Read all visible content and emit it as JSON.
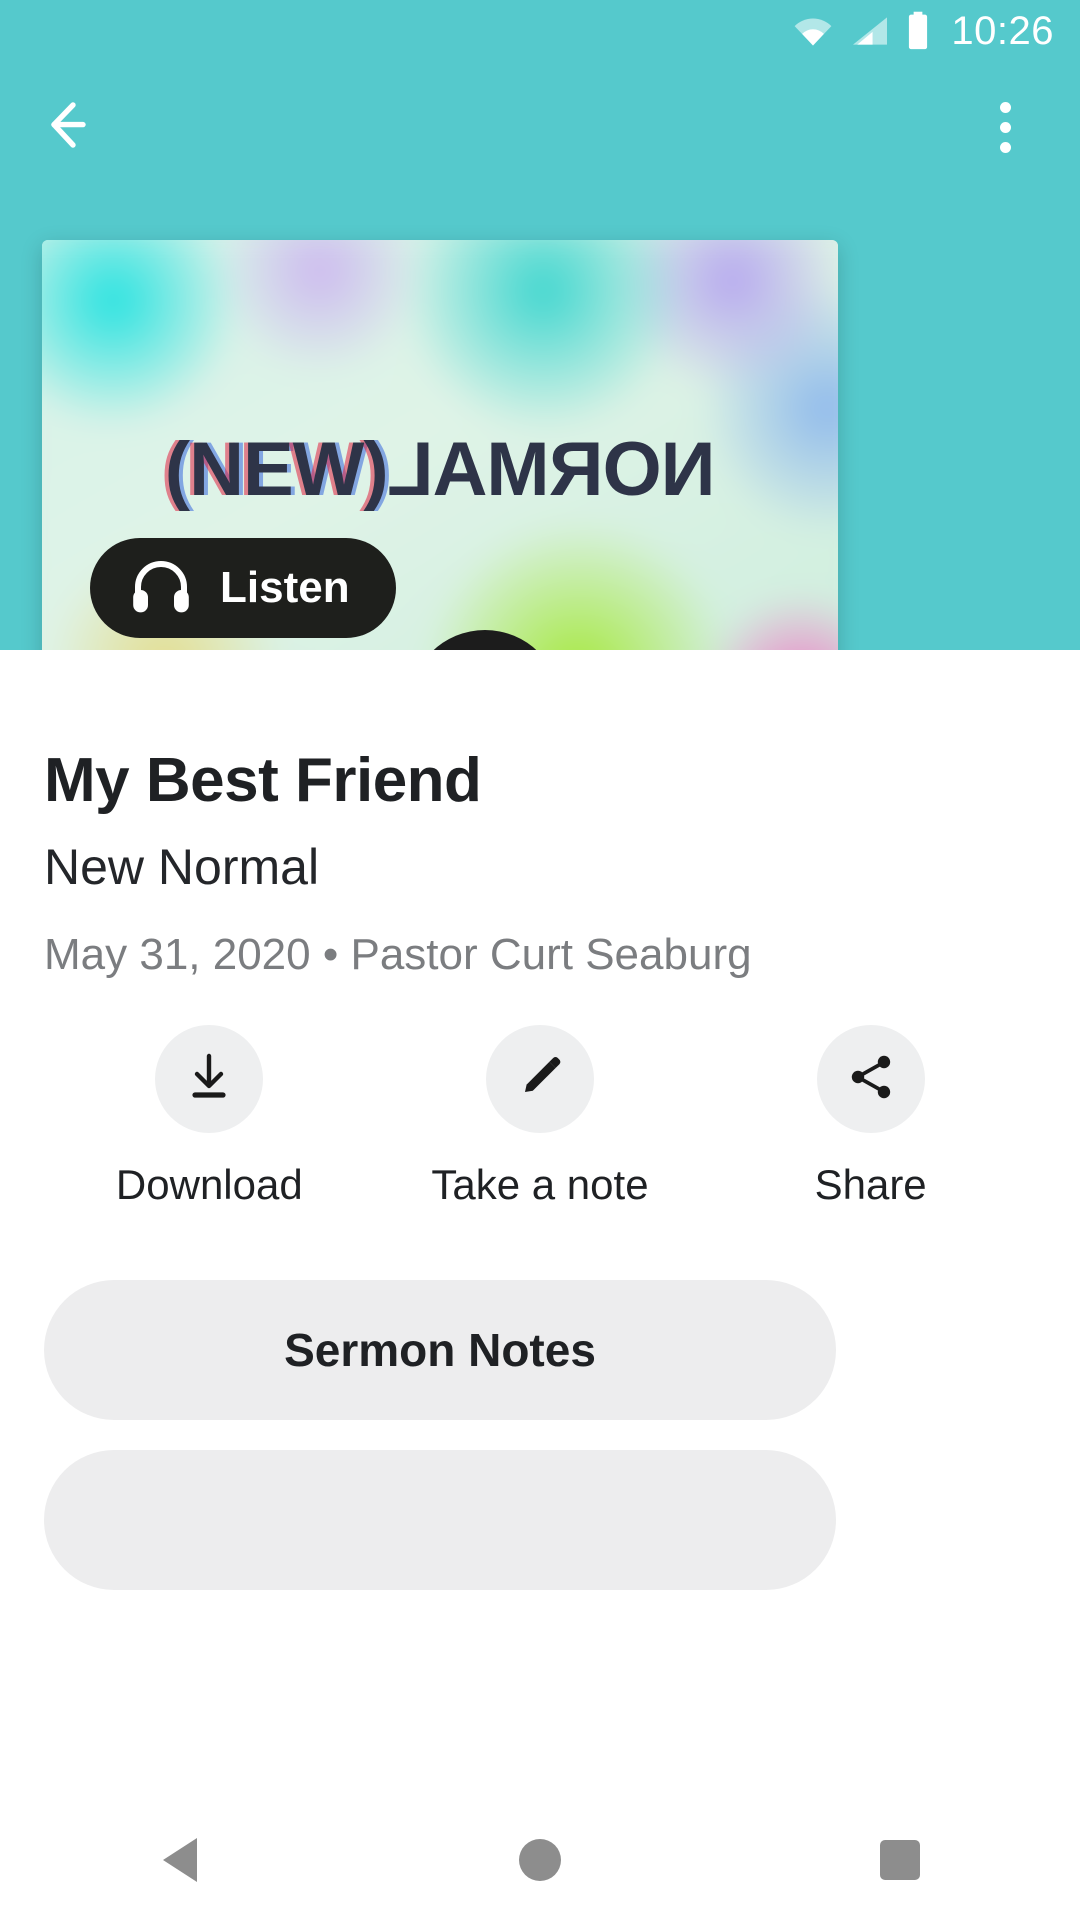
{
  "status_bar": {
    "time": "10:26",
    "icons": [
      "wifi-icon",
      "cellular-signal-icon",
      "battery-icon"
    ]
  },
  "app_bar": {
    "back_icon": "back-arrow-icon",
    "overflow_icon": "overflow-menu-icon"
  },
  "media_card": {
    "artwork_text_primary": "(NEW)",
    "artwork_text_secondary": "NORMAL",
    "play_icon": "play-icon",
    "listen_button": {
      "label": "Listen",
      "icon": "headphones-icon"
    }
  },
  "details": {
    "title": "My Best Friend",
    "series": "New Normal",
    "meta": "May 31, 2020 • Pastor Curt Seaburg",
    "date": "May 31, 2020",
    "speaker": "Pastor Curt Seaburg"
  },
  "actions": [
    {
      "label": "Download",
      "icon": "download-icon"
    },
    {
      "label": "Take a note",
      "icon": "pencil-icon"
    },
    {
      "label": "Share",
      "icon": "share-icon"
    }
  ],
  "buttons": [
    {
      "label": "Sermon Notes"
    },
    {
      "label": ""
    }
  ],
  "nav_bar": {
    "back": "nav-back-icon",
    "home": "nav-home-icon",
    "recents": "nav-recents-icon"
  },
  "colors": {
    "accent": "#55C9CC",
    "surface": "#ffffff",
    "chip": "#eeeff0",
    "text_primary": "#1f2124",
    "text_muted": "#7b7d80",
    "dark": "#1e1f1c"
  }
}
